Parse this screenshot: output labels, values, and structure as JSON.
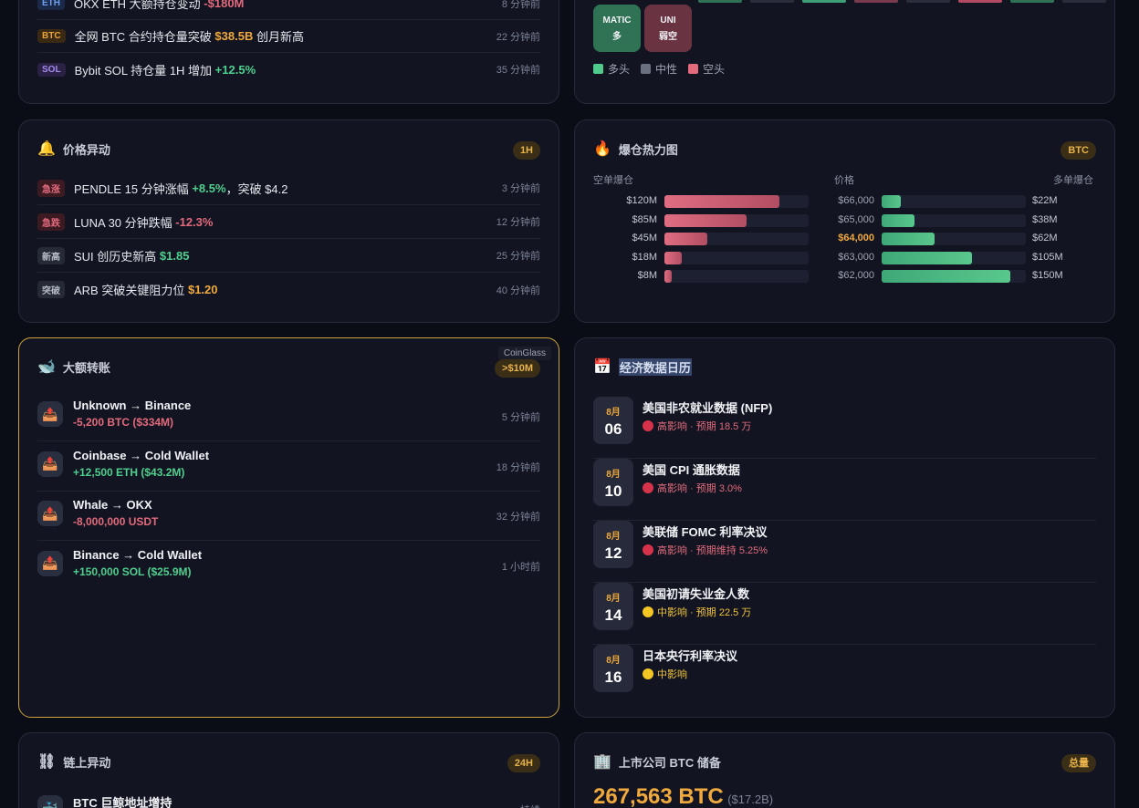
{
  "large_holdings": {
    "items": [
      {
        "tag": "ETH",
        "pre": "OKX ETH 大额持仓变动 ",
        "val": "-$180M",
        "post": "",
        "time": "8 分钟前"
      },
      {
        "tag": "BTC",
        "pre": "全网 BTC 合约持仓量突破 ",
        "val": "$38.5B",
        "post": " 创月新高",
        "time": "22 分钟前"
      },
      {
        "tag": "SOL",
        "pre": "Bybit SOL 持仓量 1H 增加 ",
        "val": "+12.5%",
        "post": "",
        "time": "35 分钟前"
      }
    ]
  },
  "sentiment": {
    "tiles": [
      {
        "sym": "MATIC",
        "label": "多",
        "color": "#2f7254"
      },
      {
        "sym": "UNI",
        "label": "弱空",
        "color": "#6a3341"
      }
    ],
    "legend": [
      {
        "label": "多头",
        "color": "#4fc98c"
      },
      {
        "label": "中性",
        "color": "#6a7080"
      },
      {
        "label": "空头",
        "color": "#e26a7c"
      }
    ]
  },
  "price_alerts": {
    "title": "价格异动",
    "badge": "1H",
    "items": [
      {
        "tag": "急涨",
        "pre": "PENDLE 15 分钟涨幅 ",
        "val": "+8.5%",
        "post": "，突破 $4.2",
        "time": "3 分钟前"
      },
      {
        "tag": "急跌",
        "pre": "LUNA 30 分钟跌幅 ",
        "val": "-12.3%",
        "post": "",
        "time": "12 分钟前"
      },
      {
        "tag": "新高",
        "pre": "SUI 创历史新高 ",
        "val": "$1.85",
        "post": "",
        "time": "25 分钟前"
      },
      {
        "tag": "突破",
        "pre": "ARB 突破关键阻力位 ",
        "val": "$1.20",
        "post": "",
        "time": "40 分钟前"
      }
    ]
  },
  "liq_heatmap": {
    "title": "爆仓热力图",
    "badge": "BTC",
    "head_short": "空单爆仓",
    "head_price": "价格",
    "head_long": "多单爆仓",
    "rows": [
      {
        "short": "$120M",
        "short_v": 120,
        "price": "$66,000",
        "long": "$22M",
        "long_v": 22
      },
      {
        "short": "$85M",
        "short_v": 85,
        "price": "$65,000",
        "long": "$38M",
        "long_v": 38
      },
      {
        "short": "$45M",
        "short_v": 45,
        "price": "$64,000",
        "long": "$62M",
        "long_v": 62
      },
      {
        "short": "$18M",
        "short_v": 18,
        "price": "$63,000",
        "long": "$105M",
        "long_v": 105
      },
      {
        "short": "$8M",
        "short_v": 8,
        "price": "$62,000",
        "long": "$150M",
        "long_v": 150
      }
    ]
  },
  "whale_transfers": {
    "title": "大额转账",
    "badge": ">$10M",
    "tooltip": "CoinGlass",
    "items": [
      {
        "title": "Unknown → Binance",
        "sub": "-5,200 BTC ($334M)",
        "dir": "red",
        "time": "5 分钟前"
      },
      {
        "title": "Coinbase → Cold Wallet",
        "sub": "+12,500 ETH ($43.2M)",
        "dir": "green",
        "time": "18 分钟前"
      },
      {
        "title": "Whale → OKX",
        "sub": "-8,000,000 USDT",
        "dir": "red",
        "time": "32 分钟前"
      },
      {
        "title": "Binance → Cold Wallet",
        "sub": "+150,000 SOL ($25.9M)",
        "dir": "green",
        "time": "1 小时前"
      }
    ]
  },
  "econ_calendar": {
    "title": "经济数据日历",
    "items": [
      {
        "month": "8月",
        "day": "06",
        "title": "美国非农就业数据 (NFP)",
        "level": "r",
        "sub": "高影响 · 预期 18.5 万"
      },
      {
        "month": "8月",
        "day": "10",
        "title": "美国 CPI 通胀数据",
        "level": "r",
        "sub": "高影响 · 预期 3.0%"
      },
      {
        "month": "8月",
        "day": "12",
        "title": "美联储 FOMC 利率决议",
        "level": "r",
        "sub": "高影响 · 预期维持 5.25%"
      },
      {
        "month": "8月",
        "day": "14",
        "title": "美国初请失业金人数",
        "level": "y",
        "sub": "中影响 · 预期 22.5 万"
      },
      {
        "month": "8月",
        "day": "16",
        "title": "日本央行利率决议",
        "level": "y",
        "sub": "中影响"
      }
    ]
  },
  "onchain": {
    "title": "链上异动",
    "badge": "24H",
    "first_item": "BTC 巨鲸地址增持",
    "first_time": "持续"
  },
  "btc_reserves": {
    "title": "上市公司 BTC 储备",
    "badge": "总量",
    "amount": "267,563 BTC",
    "usd": "($17.2B)"
  },
  "colors": {
    "green": "#4fcf8e",
    "red": "#e26a7c",
    "gold": "#f0a93c"
  }
}
